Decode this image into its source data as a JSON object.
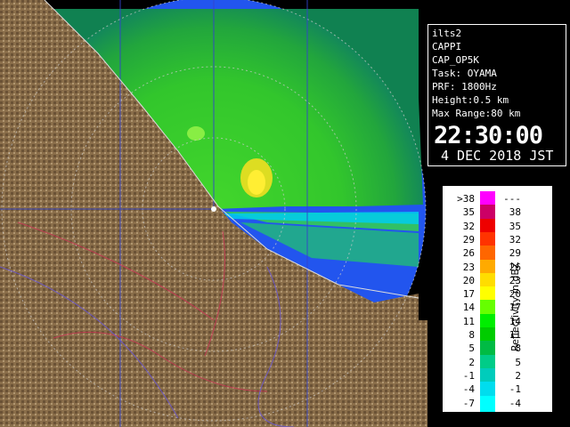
{
  "info": {
    "lines": [
      "ilts2",
      "CAPPI",
      "CAP_OP5K",
      "Task: OYAMA",
      "PRF: 1800Hz",
      "Height:0.5 km",
      "Max Range:80 km"
    ],
    "time": "22:30:00",
    "date": "4 DEC 2018 JST"
  },
  "legend": {
    "title": "Reflectivity in dBZ",
    "rows": [
      {
        "lo": ">38",
        "hi": "---",
        "color": "#ff00ff"
      },
      {
        "lo": "35",
        "hi": "38",
        "color": "#cc0066"
      },
      {
        "lo": "32",
        "hi": "35",
        "color": "#ee0000"
      },
      {
        "lo": "29",
        "hi": "32",
        "color": "#ff3300"
      },
      {
        "lo": "26",
        "hi": "29",
        "color": "#ff6600"
      },
      {
        "lo": "23",
        "hi": "26",
        "color": "#ffaa00"
      },
      {
        "lo": "20",
        "hi": "23",
        "color": "#ffdd00"
      },
      {
        "lo": "17",
        "hi": "20",
        "color": "#ffff00"
      },
      {
        "lo": "14",
        "hi": "17",
        "color": "#66ff00"
      },
      {
        "lo": "11",
        "hi": "14",
        "color": "#00ee00"
      },
      {
        "lo": "8",
        "hi": "11",
        "color": "#00cc00"
      },
      {
        "lo": "5",
        "hi": "8",
        "color": "#00bb44"
      },
      {
        "lo": "2",
        "hi": "5",
        "color": "#00cc88"
      },
      {
        "lo": "-1",
        "hi": "2",
        "color": "#00ccbb"
      },
      {
        "lo": "-4",
        "hi": "-1",
        "color": "#00ddee"
      },
      {
        "lo": "-7",
        "hi": "-4",
        "color": "#00ffff"
      }
    ]
  },
  "colors": {
    "sea": "#2a4fe0",
    "land": "#8a6e4a",
    "echo_weak": "#22cc33",
    "echo_mid": "#44ee44",
    "echo_strong": "#dddd22",
    "echo_edge": "#00ccee"
  }
}
